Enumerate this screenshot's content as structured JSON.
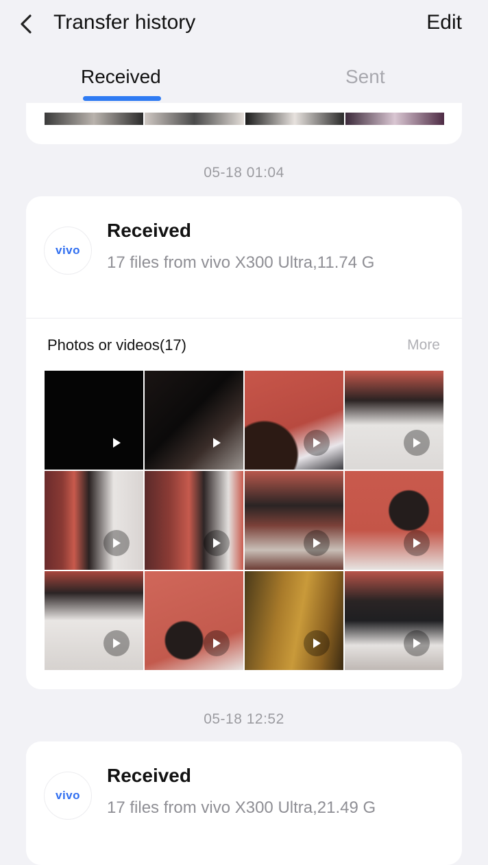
{
  "header": {
    "title": "Transfer history",
    "edit_label": "Edit",
    "tabs": [
      {
        "label": "Received",
        "active": true
      },
      {
        "label": "Sent",
        "active": false
      }
    ]
  },
  "colors": {
    "accent": "#2f7bf3",
    "vivo_brand": "#2f6ef0",
    "background": "#f2f2f6"
  },
  "groups": [
    {
      "date": "05-18 01:04",
      "device_logo": "vivo",
      "status": "Received",
      "summary": "17 files from vivo X300 Ultra,11.74 G",
      "section_label": "Photos or videos(17)",
      "more_label": "More",
      "thumbnails_shown": 12
    },
    {
      "date": "05-18 12:52",
      "device_logo": "vivo",
      "status": "Received",
      "summary": "17 files from vivo X300 Ultra,21.49 G"
    }
  ]
}
